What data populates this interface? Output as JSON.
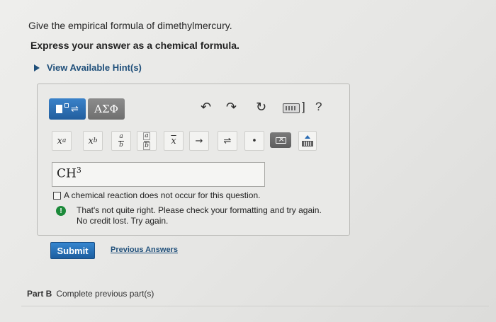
{
  "question": {
    "text": "Give the empirical formula of dimethylmercury.",
    "instruction": "Express your answer as a chemical formula.",
    "hints_link": "View Available Hint(s)"
  },
  "toolbar": {
    "greek_label": "ΑΣΦ",
    "undo_icon": "↶",
    "redo_icon": "↷",
    "reset_icon": "↻",
    "keyboard_bracket": "]",
    "help_label": "?",
    "keys": {
      "superscript_base": "x",
      "superscript_exp": "a",
      "subscript_base": "x",
      "subscript_sub": "b",
      "frac_num": "a",
      "frac_den": "b",
      "box_frac_num": "a",
      "box_frac_den": "b",
      "overline": "x",
      "arrow_right": "→",
      "equilibrium": "⇌",
      "dot": "•"
    }
  },
  "answer": {
    "base": "CH",
    "superscript": "3"
  },
  "no_reaction_label": "A chemical reaction does not occur for this question.",
  "feedback": {
    "line1": "That's not quite right. Please check your formatting and try again.",
    "line2": "No credit lost. Try again."
  },
  "actions": {
    "submit_label": "Submit",
    "previous_answers_label": "Previous Answers"
  },
  "part_b": {
    "label": "Part B",
    "text": "Complete previous part(s)"
  },
  "colors": {
    "accent": "#2b6cb3",
    "feedback_icon": "#1c8a3a"
  }
}
